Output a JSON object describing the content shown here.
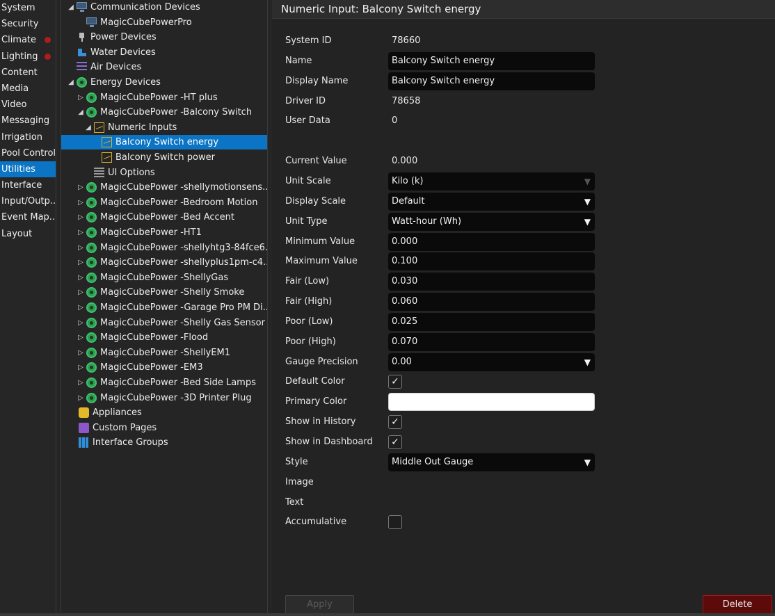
{
  "nav": {
    "items": [
      {
        "label": "System",
        "badge": false,
        "active": false
      },
      {
        "label": "Security",
        "badge": false,
        "active": false
      },
      {
        "label": "Climate",
        "badge": true,
        "active": false
      },
      {
        "label": "Lighting",
        "badge": true,
        "active": false
      },
      {
        "label": "Content",
        "badge": false,
        "active": false
      },
      {
        "label": "Media",
        "badge": false,
        "active": false
      },
      {
        "label": "Video",
        "badge": false,
        "active": false
      },
      {
        "label": "Messaging",
        "badge": false,
        "active": false
      },
      {
        "label": "Irrigation",
        "badge": false,
        "active": false
      },
      {
        "label": "Pool Control",
        "badge": false,
        "active": false
      },
      {
        "label": "Utilities",
        "badge": false,
        "active": true
      },
      {
        "label": "Interface",
        "badge": false,
        "active": false
      },
      {
        "label": "Input/Outp...",
        "badge": false,
        "active": false
      },
      {
        "label": "Event Map...",
        "badge": false,
        "active": false
      },
      {
        "label": "Layout",
        "badge": false,
        "active": false
      }
    ],
    "badge_color": "#b01c1c",
    "active_color": "#0b74c4"
  },
  "tree": {
    "rows": [
      {
        "label": "Communication Devices",
        "level": 0,
        "arrow": "expanded",
        "icon": "monitor-icon"
      },
      {
        "label": "MagicCubePowerPro",
        "level": 1,
        "arrow": "none",
        "icon": "monitor-icon"
      },
      {
        "label": "Power Devices",
        "level": 0,
        "arrow": "none",
        "icon": "plug-icon"
      },
      {
        "label": "Water Devices",
        "level": 0,
        "arrow": "none",
        "icon": "water-icon"
      },
      {
        "label": "Air Devices",
        "level": 0,
        "arrow": "none",
        "icon": "air-icon"
      },
      {
        "label": "Energy Devices",
        "level": 0,
        "arrow": "expanded",
        "icon": "gear-icon"
      },
      {
        "label": "MagicCubePower -HT plus",
        "level": 1,
        "arrow": "collapsed",
        "icon": "gear-icon"
      },
      {
        "label": "MagicCubePower -Balcony Switch",
        "level": 1,
        "arrow": "expanded",
        "icon": "gear-icon"
      },
      {
        "label": "Numeric Inputs",
        "level": 2,
        "arrow": "expanded",
        "icon": "chart-icon"
      },
      {
        "label": "Balcony Switch energy",
        "level": 3,
        "arrow": "none",
        "icon": "chart-icon",
        "selected": true
      },
      {
        "label": "Balcony Switch power",
        "level": 3,
        "arrow": "none",
        "icon": "chart-icon"
      },
      {
        "label": "UI Options",
        "level": 2,
        "arrow": "none",
        "icon": "list-icon"
      },
      {
        "label": "MagicCubePower -shellymotionsens...",
        "level": 1,
        "arrow": "collapsed",
        "icon": "gear-icon"
      },
      {
        "label": "MagicCubePower -Bedroom Motion",
        "level": 1,
        "arrow": "collapsed",
        "icon": "gear-icon"
      },
      {
        "label": "MagicCubePower -Bed Accent",
        "level": 1,
        "arrow": "collapsed",
        "icon": "gear-icon"
      },
      {
        "label": "MagicCubePower -HT1",
        "level": 1,
        "arrow": "collapsed",
        "icon": "gear-icon"
      },
      {
        "label": "MagicCubePower -shellyhtg3-84fce6...",
        "level": 1,
        "arrow": "collapsed",
        "icon": "gear-icon"
      },
      {
        "label": "MagicCubePower -shellyplus1pm-c4...",
        "level": 1,
        "arrow": "collapsed",
        "icon": "gear-icon"
      },
      {
        "label": "MagicCubePower -ShellyGas",
        "level": 1,
        "arrow": "collapsed",
        "icon": "gear-icon"
      },
      {
        "label": "MagicCubePower -Shelly Smoke",
        "level": 1,
        "arrow": "collapsed",
        "icon": "gear-icon"
      },
      {
        "label": "MagicCubePower -Garage Pro PM Di...",
        "level": 1,
        "arrow": "collapsed",
        "icon": "gear-icon"
      },
      {
        "label": "MagicCubePower -Shelly Gas Sensor",
        "level": 1,
        "arrow": "collapsed",
        "icon": "gear-icon"
      },
      {
        "label": "MagicCubePower -Flood",
        "level": 1,
        "arrow": "collapsed",
        "icon": "gear-icon"
      },
      {
        "label": "MagicCubePower -ShellyEM1",
        "level": 1,
        "arrow": "collapsed",
        "icon": "gear-icon"
      },
      {
        "label": "MagicCubePower -EM3",
        "level": 1,
        "arrow": "collapsed",
        "icon": "gear-icon"
      },
      {
        "label": "MagicCubePower -Bed Side Lamps",
        "level": 1,
        "arrow": "collapsed",
        "icon": "gear-icon"
      },
      {
        "label": "MagicCubePower -3D Printer Plug",
        "level": 1,
        "arrow": "collapsed",
        "icon": "gear-icon"
      },
      {
        "label": "Appliances",
        "level": 0.5,
        "arrow": "none",
        "icon": "appliances-icon"
      },
      {
        "label": "Custom Pages",
        "level": 0.5,
        "arrow": "none",
        "icon": "pages-icon"
      },
      {
        "label": "Interface Groups",
        "level": 0.5,
        "arrow": "none",
        "icon": "groups-icon"
      }
    ]
  },
  "panel": {
    "title": "Numeric Input: Balcony Switch energy",
    "fields": [
      {
        "label": "System ID",
        "type": "text",
        "value": "78660"
      },
      {
        "label": "Name",
        "type": "input",
        "value": "Balcony Switch energy"
      },
      {
        "label": "Display Name",
        "type": "input",
        "value": "Balcony Switch energy"
      },
      {
        "label": "Driver ID",
        "type": "text",
        "value": "78658"
      },
      {
        "label": "User Data",
        "type": "text",
        "value": "0"
      },
      {
        "label": "",
        "type": "spacer",
        "value": ""
      },
      {
        "label": "Current Value",
        "type": "text",
        "value": "0.000"
      },
      {
        "label": "Unit Scale",
        "type": "dropdown-disabled",
        "value": "Kilo (k)"
      },
      {
        "label": "Display Scale",
        "type": "dropdown",
        "value": "Default"
      },
      {
        "label": "Unit Type",
        "type": "dropdown",
        "value": "Watt-hour (Wh)"
      },
      {
        "label": "Minimum Value",
        "type": "input",
        "value": "0.000"
      },
      {
        "label": "Maximum Value",
        "type": "input",
        "value": "0.100"
      },
      {
        "label": "Fair (Low)",
        "type": "input",
        "value": "0.030"
      },
      {
        "label": "Fair (High)",
        "type": "input",
        "value": "0.060"
      },
      {
        "label": "Poor (Low)",
        "type": "input",
        "value": "0.025"
      },
      {
        "label": "Poor (High)",
        "type": "input",
        "value": "0.070"
      },
      {
        "label": "Gauge Precision",
        "type": "dropdown",
        "value": "0.00"
      },
      {
        "label": "Default Color",
        "type": "checkbox",
        "checked": true
      },
      {
        "label": "Primary Color",
        "type": "color",
        "value": "#ffffff"
      },
      {
        "label": "Show in History",
        "type": "checkbox",
        "checked": true
      },
      {
        "label": "Show in Dashboard",
        "type": "checkbox",
        "checked": true
      },
      {
        "label": "Style",
        "type": "dropdown",
        "value": "Middle Out Gauge"
      },
      {
        "label": "Image",
        "type": "text",
        "value": ""
      },
      {
        "label": "Text",
        "type": "text",
        "value": ""
      },
      {
        "label": "Accumulative",
        "type": "checkbox",
        "checked": false
      }
    ],
    "apply_label": "Apply",
    "delete_label": "Delete"
  }
}
